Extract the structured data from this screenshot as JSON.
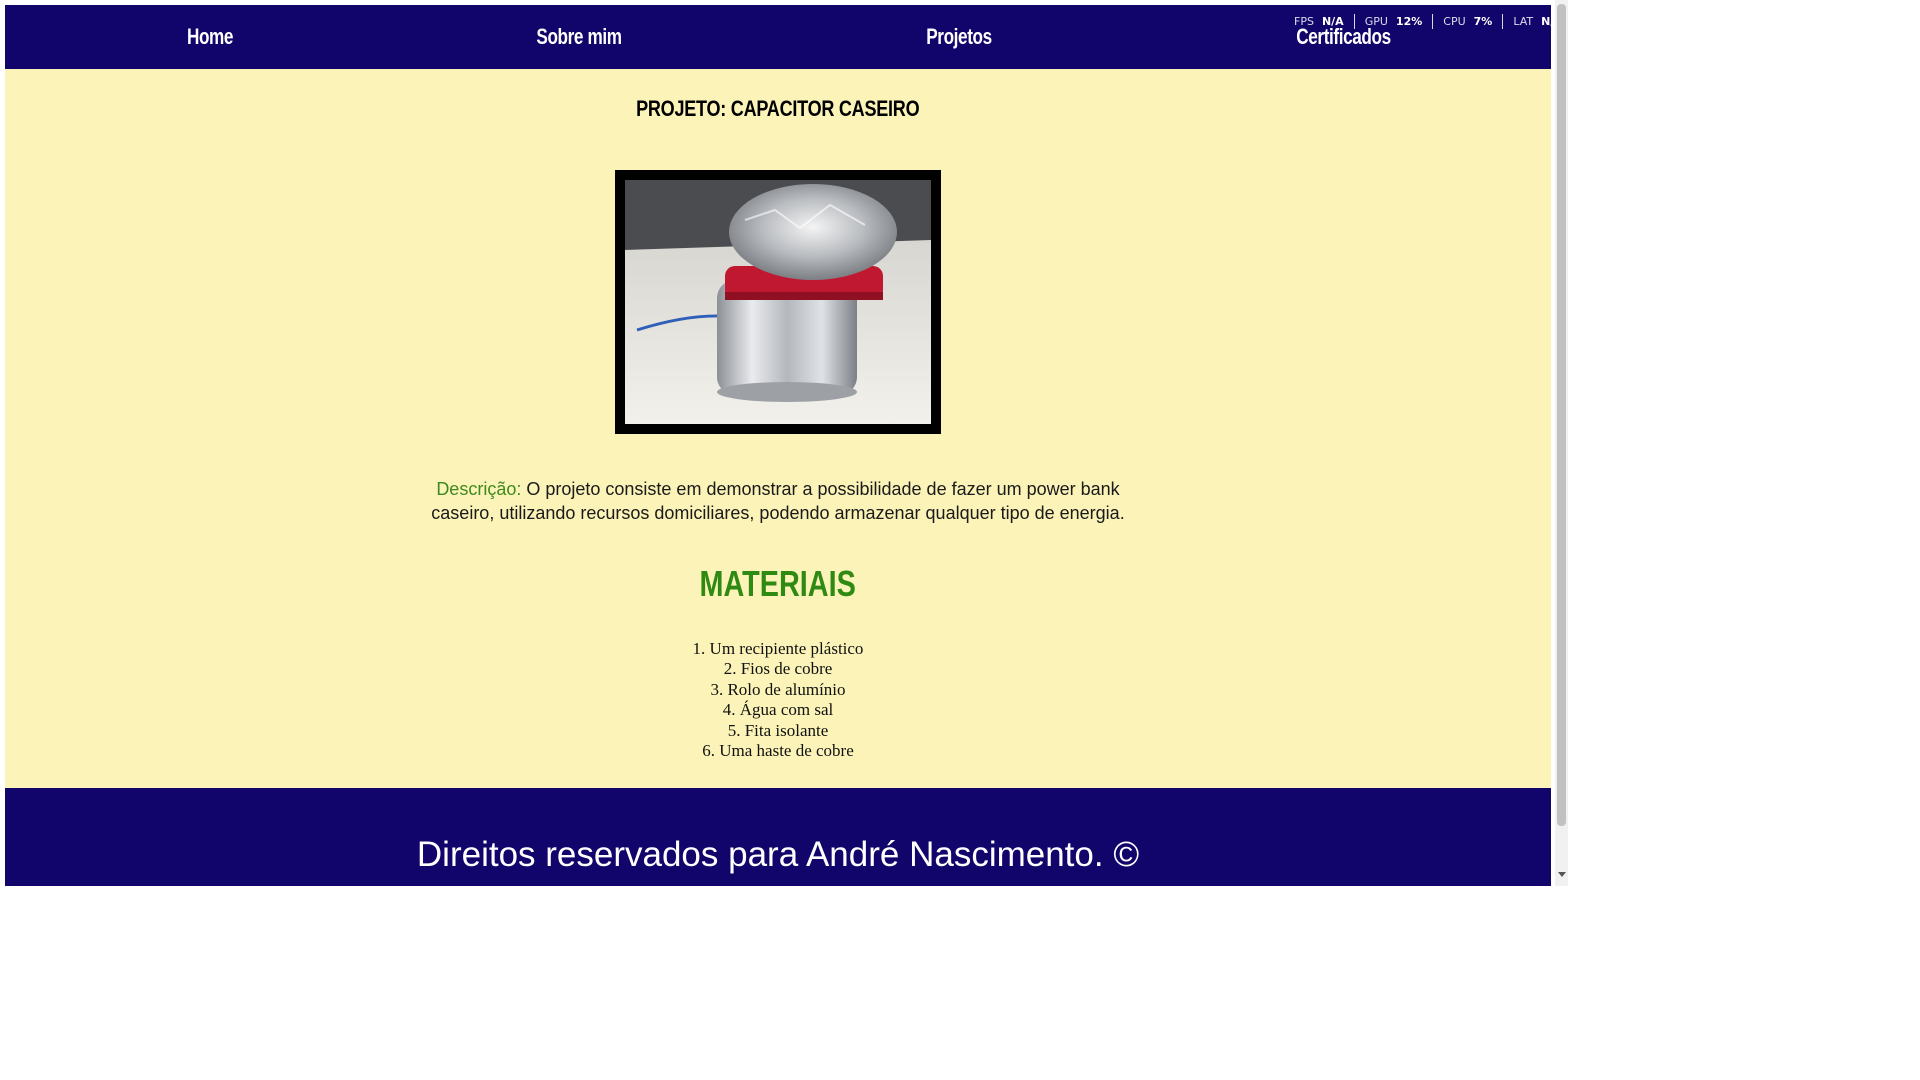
{
  "nav": {
    "home": "Home",
    "about": "Sobre mim",
    "projects": "Projetos",
    "certificates": "Certificados"
  },
  "perf": {
    "fps_label": "FPS",
    "fps_value": "N/A",
    "gpu_label": "GPU",
    "gpu_value": "12%",
    "cpu_label": "CPU",
    "cpu_value": "7%",
    "lat_label": "LAT",
    "lat_value": "N/A"
  },
  "page": {
    "title": "PROJETO: CAPACITOR CASEIRO",
    "description_label": "Descrição:",
    "description_text": "O projeto consiste em demonstrar a possibilidade de fazer um power bank caseiro, utilizando recursos domiciliares, podendo armazenar qualquer tipo de energia.",
    "materials_title": "MATERIAIS",
    "materials": [
      "1. Um recipiente plástico",
      "2. Fios de cobre",
      "3. Rolo de alumínio",
      "4. Água com sal",
      "5. Fita isolante",
      "6. Uma haste de cobre"
    ]
  },
  "footer": {
    "text": "Direitos reservados para André Nascimento. ©"
  },
  "colors": {
    "nav_background": "#11046a",
    "page_background": "#fbf3b7",
    "accent_green": "#2f8a14"
  }
}
